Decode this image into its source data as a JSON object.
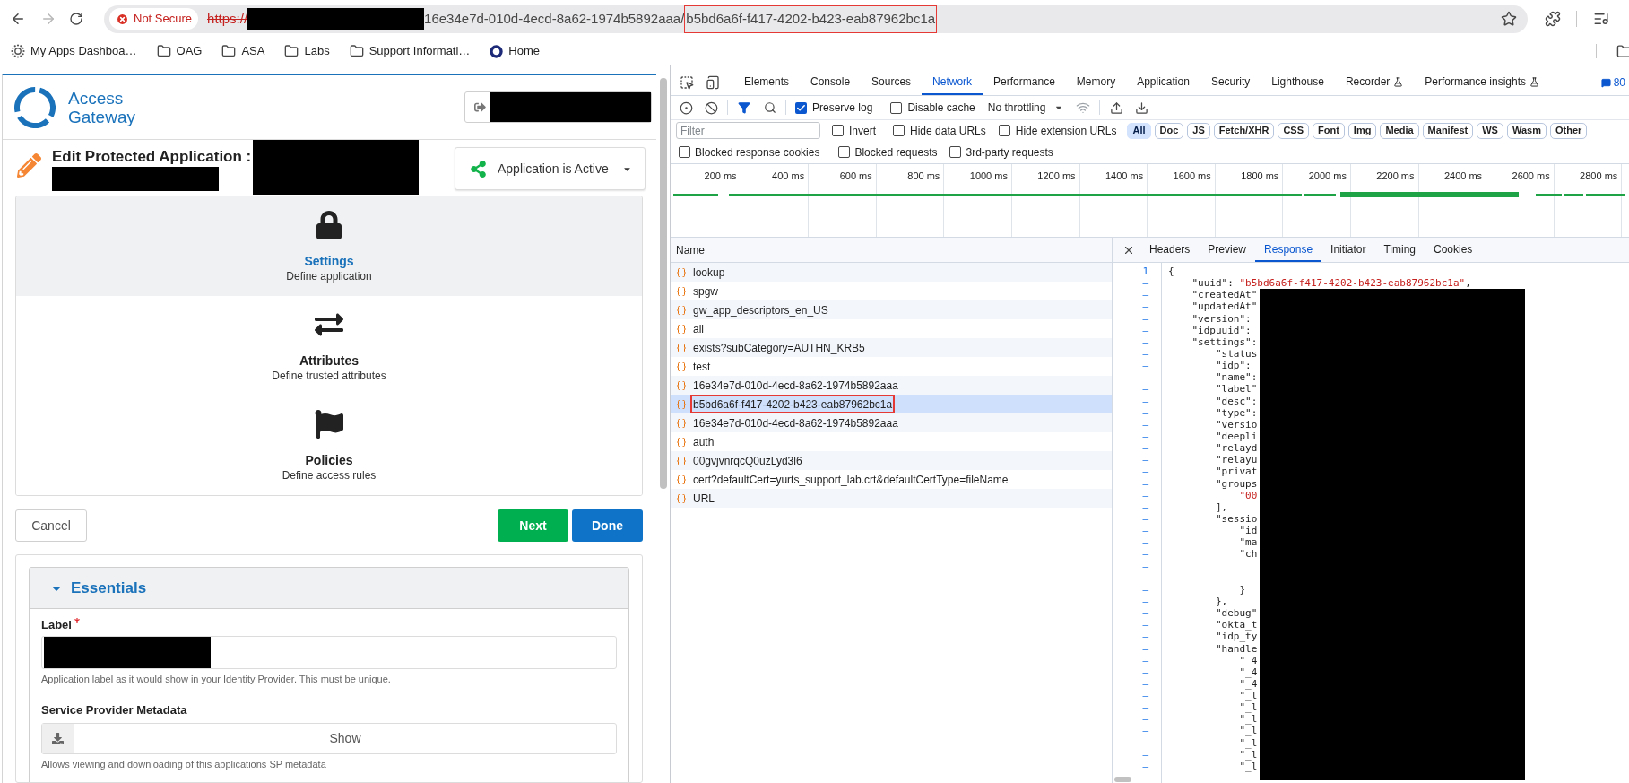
{
  "browser": {
    "security_chip": "Not Secure",
    "url": {
      "scheme": "https://",
      "path": "16e34e7d-010d-4ecd-8a62-1974b5892aaa/",
      "highlighted_part": "b5bd6a6f-f417-4202-b423-eab87962bc1a"
    }
  },
  "bookmarks": [
    {
      "label": "My Apps Dashboa…",
      "kind": "site"
    },
    {
      "label": "OAG",
      "kind": "folder"
    },
    {
      "label": "ASA",
      "kind": "folder"
    },
    {
      "label": "Labs",
      "kind": "folder"
    },
    {
      "label": "Support Informati…",
      "kind": "folder"
    },
    {
      "label": "Home",
      "kind": "home"
    }
  ],
  "app": {
    "logo_text": "Access Gateway",
    "title": "Edit Protected Application :",
    "status_button": "Application is Active",
    "steps": [
      {
        "title": "Settings",
        "subtitle": "Define application",
        "selected": true
      },
      {
        "title": "Attributes",
        "subtitle": "Define trusted attributes",
        "selected": false
      },
      {
        "title": "Policies",
        "subtitle": "Define access rules",
        "selected": false
      }
    ],
    "actions": [
      {
        "label": "Cancel",
        "kind": "secondary"
      },
      {
        "label": "Next",
        "kind": "success"
      },
      {
        "label": "Done",
        "kind": "primary"
      }
    ],
    "section": {
      "title": "Essentials",
      "expanded": true,
      "fields": [
        {
          "label": "Label",
          "required": true,
          "kind": "text",
          "help": "Application label as it would show in your Identity Provider. This must be unique."
        },
        {
          "label": "Service Provider Metadata",
          "required": false,
          "kind": "download",
          "button": "Show",
          "help": "Allows viewing and downloading of this applications SP metadata"
        }
      ]
    }
  },
  "devtools": {
    "tabs": [
      {
        "label": "Elements",
        "selected": false,
        "experimental": false
      },
      {
        "label": "Console",
        "selected": false,
        "experimental": false
      },
      {
        "label": "Sources",
        "selected": false,
        "experimental": false
      },
      {
        "label": "Network",
        "selected": true,
        "experimental": false
      },
      {
        "label": "Performance",
        "selected": false,
        "experimental": false
      },
      {
        "label": "Memory",
        "selected": false,
        "experimental": false
      },
      {
        "label": "Application",
        "selected": false,
        "experimental": false
      },
      {
        "label": "Security",
        "selected": false,
        "experimental": false
      },
      {
        "label": "Lighthouse",
        "selected": false,
        "experimental": false
      },
      {
        "label": "Recorder",
        "selected": false,
        "experimental": true
      },
      {
        "label": "Performance insights",
        "selected": false,
        "experimental": true
      }
    ],
    "issues_count": "80",
    "toolbar": {
      "checkboxes": [
        {
          "label": "Preserve log",
          "checked": true
        },
        {
          "label": "Disable cache",
          "checked": false
        }
      ],
      "throttling": "No throttling"
    },
    "filter": {
      "placeholder": "Filter",
      "checkboxes": [
        {
          "label": "Invert",
          "checked": false
        },
        {
          "label": "Hide data URLs",
          "checked": false
        },
        {
          "label": "Hide extension URLs",
          "checked": false
        }
      ],
      "types": [
        {
          "label": "All",
          "selected": true
        },
        {
          "label": "Doc",
          "selected": false
        },
        {
          "label": "JS",
          "selected": false
        },
        {
          "label": "Fetch/XHR",
          "selected": false
        },
        {
          "label": "CSS",
          "selected": false
        },
        {
          "label": "Font",
          "selected": false
        },
        {
          "label": "Img",
          "selected": false
        },
        {
          "label": "Media",
          "selected": false
        },
        {
          "label": "Manifest",
          "selected": false
        },
        {
          "label": "WS",
          "selected": false
        },
        {
          "label": "Wasm",
          "selected": false
        },
        {
          "label": "Other",
          "selected": false
        }
      ]
    },
    "request_options": [
      {
        "label": "Blocked response cookies",
        "checked": false
      },
      {
        "label": "Blocked requests",
        "checked": false
      },
      {
        "label": "3rd-party requests",
        "checked": false
      }
    ],
    "timeline": {
      "ticks": [
        "200 ms",
        "400 ms",
        "600 ms",
        "800 ms",
        "1000 ms",
        "1200 ms",
        "1400 ms",
        "1600 ms",
        "1800 ms",
        "2000 ms",
        "2200 ms",
        "2400 ms",
        "2600 ms",
        "2800 ms"
      ]
    },
    "requests": {
      "column": "Name",
      "rows": [
        {
          "name": "lookup",
          "selected": false,
          "highlighted": false
        },
        {
          "name": "spgw",
          "selected": false,
          "highlighted": false
        },
        {
          "name": "gw_app_descriptors_en_US",
          "selected": false,
          "highlighted": false
        },
        {
          "name": "all",
          "selected": false,
          "highlighted": false
        },
        {
          "name": "exists?subCategory=AUTHN_KRB5",
          "selected": false,
          "highlighted": false
        },
        {
          "name": "test",
          "selected": false,
          "highlighted": false
        },
        {
          "name": "16e34e7d-010d-4ecd-8a62-1974b5892aaa",
          "selected": false,
          "highlighted": false
        },
        {
          "name": "b5bd6a6f-f417-4202-b423-eab87962bc1a",
          "selected": true,
          "highlighted": true
        },
        {
          "name": "16e34e7d-010d-4ecd-8a62-1974b5892aaa",
          "selected": false,
          "highlighted": false
        },
        {
          "name": "auth",
          "selected": false,
          "highlighted": false
        },
        {
          "name": "00gvjvnrqcQ0uzLyd3l6",
          "selected": false,
          "highlighted": false
        },
        {
          "name": "cert?defaultCert=yurts_support_lab.crt&defaultCertType=fileName",
          "selected": false,
          "highlighted": false
        },
        {
          "name": "URL",
          "selected": false,
          "highlighted": false
        }
      ]
    },
    "detail": {
      "tabs": [
        {
          "label": "Headers",
          "selected": false
        },
        {
          "label": "Preview",
          "selected": false
        },
        {
          "label": "Response",
          "selected": true
        },
        {
          "label": "Initiator",
          "selected": false
        },
        {
          "label": "Timing",
          "selected": false
        },
        {
          "label": "Cookies",
          "selected": false
        }
      ],
      "lines": [
        {
          "number": "1",
          "parts": [
            {
              "kind": "punct",
              "text": "{"
            }
          ]
        },
        {
          "number": "–",
          "parts": [
            {
              "kind": "key",
              "text": "    \"uuid\": "
            },
            {
              "kind": "string",
              "text": "\"b5bd6a6f-f417-4202-b423-eab87962bc1a\""
            },
            {
              "kind": "punct",
              "text": ","
            }
          ]
        },
        {
          "number": "–",
          "parts": [
            {
              "kind": "key",
              "text": "    \"createdAt\""
            }
          ]
        },
        {
          "number": "–",
          "parts": [
            {
              "kind": "key",
              "text": "    \"updatedAt\""
            }
          ]
        },
        {
          "number": "–",
          "parts": [
            {
              "kind": "key",
              "text": "    \"version\":"
            }
          ]
        },
        {
          "number": "–",
          "parts": [
            {
              "kind": "key",
              "text": "    \"idpuuid\":"
            }
          ]
        },
        {
          "number": "–",
          "parts": [
            {
              "kind": "key",
              "text": "    \"settings\":"
            }
          ]
        },
        {
          "number": "–",
          "parts": [
            {
              "kind": "key",
              "text": "        \"status"
            }
          ]
        },
        {
          "number": "–",
          "parts": [
            {
              "kind": "key",
              "text": "        \"idp\":"
            }
          ]
        },
        {
          "number": "–",
          "parts": [
            {
              "kind": "key",
              "text": "        \"name\":"
            }
          ]
        },
        {
          "number": "–",
          "parts": [
            {
              "kind": "key",
              "text": "        \"label\""
            }
          ]
        },
        {
          "number": "–",
          "parts": [
            {
              "kind": "key",
              "text": "        \"desc\":"
            }
          ]
        },
        {
          "number": "–",
          "parts": [
            {
              "kind": "key",
              "text": "        \"type\":"
            }
          ]
        },
        {
          "number": "–",
          "parts": [
            {
              "kind": "key",
              "text": "        \"versio"
            }
          ]
        },
        {
          "number": "–",
          "parts": [
            {
              "kind": "key",
              "text": "        \"deepli"
            }
          ]
        },
        {
          "number": "–",
          "parts": [
            {
              "kind": "key",
              "text": "        \"relayd"
            }
          ]
        },
        {
          "number": "–",
          "parts": [
            {
              "kind": "key",
              "text": "        \"relayu"
            }
          ]
        },
        {
          "number": "–",
          "parts": [
            {
              "kind": "key",
              "text": "        \"privat"
            }
          ]
        },
        {
          "number": "–",
          "parts": [
            {
              "kind": "key",
              "text": "        \"groups"
            }
          ]
        },
        {
          "number": "–",
          "parts": [
            {
              "kind": "string",
              "text": "            \"00"
            }
          ]
        },
        {
          "number": "–",
          "parts": [
            {
              "kind": "punct",
              "text": "        ],"
            }
          ]
        },
        {
          "number": "–",
          "parts": [
            {
              "kind": "key",
              "text": "        \"sessio"
            }
          ]
        },
        {
          "number": "–",
          "parts": [
            {
              "kind": "key",
              "text": "            \"id"
            }
          ]
        },
        {
          "number": "–",
          "parts": [
            {
              "kind": "key",
              "text": "            \"ma"
            }
          ]
        },
        {
          "number": "–",
          "parts": [
            {
              "kind": "key",
              "text": "            \"ch"
            }
          ]
        },
        {
          "number": "–"
        },
        {
          "number": "–"
        },
        {
          "number": "–",
          "parts": [
            {
              "kind": "punct",
              "text": "            }"
            }
          ]
        },
        {
          "number": "–",
          "parts": [
            {
              "kind": "punct",
              "text": "        },"
            }
          ]
        },
        {
          "number": "–",
          "parts": [
            {
              "kind": "key",
              "text": "        \"debug\""
            }
          ]
        },
        {
          "number": "–",
          "parts": [
            {
              "kind": "key",
              "text": "        \"okta_t"
            }
          ]
        },
        {
          "number": "–",
          "parts": [
            {
              "kind": "key",
              "text": "        \"idp_ty"
            }
          ]
        },
        {
          "number": "–",
          "parts": [
            {
              "kind": "key",
              "text": "        \"handle"
            }
          ]
        },
        {
          "number": "–",
          "parts": [
            {
              "kind": "key",
              "text": "            \"_4"
            }
          ]
        },
        {
          "number": "–",
          "parts": [
            {
              "kind": "key",
              "text": "            \"_4"
            }
          ]
        },
        {
          "number": "–",
          "parts": [
            {
              "kind": "key",
              "text": "            \"_4"
            }
          ]
        },
        {
          "number": "–",
          "parts": [
            {
              "kind": "key",
              "text": "            \"_l"
            }
          ]
        },
        {
          "number": "–",
          "parts": [
            {
              "kind": "key",
              "text": "            \"_l"
            }
          ]
        },
        {
          "number": "–",
          "parts": [
            {
              "kind": "key",
              "text": "            \"_l"
            }
          ]
        },
        {
          "number": "–",
          "parts": [
            {
              "kind": "key",
              "text": "            \"_l"
            }
          ]
        },
        {
          "number": "–",
          "parts": [
            {
              "kind": "key",
              "text": "            \"_l"
            }
          ]
        },
        {
          "number": "–",
          "parts": [
            {
              "kind": "key",
              "text": "            \"_l"
            }
          ]
        },
        {
          "number": "–",
          "parts": [
            {
              "kind": "key",
              "text": "            \"_l"
            }
          ]
        }
      ]
    }
  }
}
